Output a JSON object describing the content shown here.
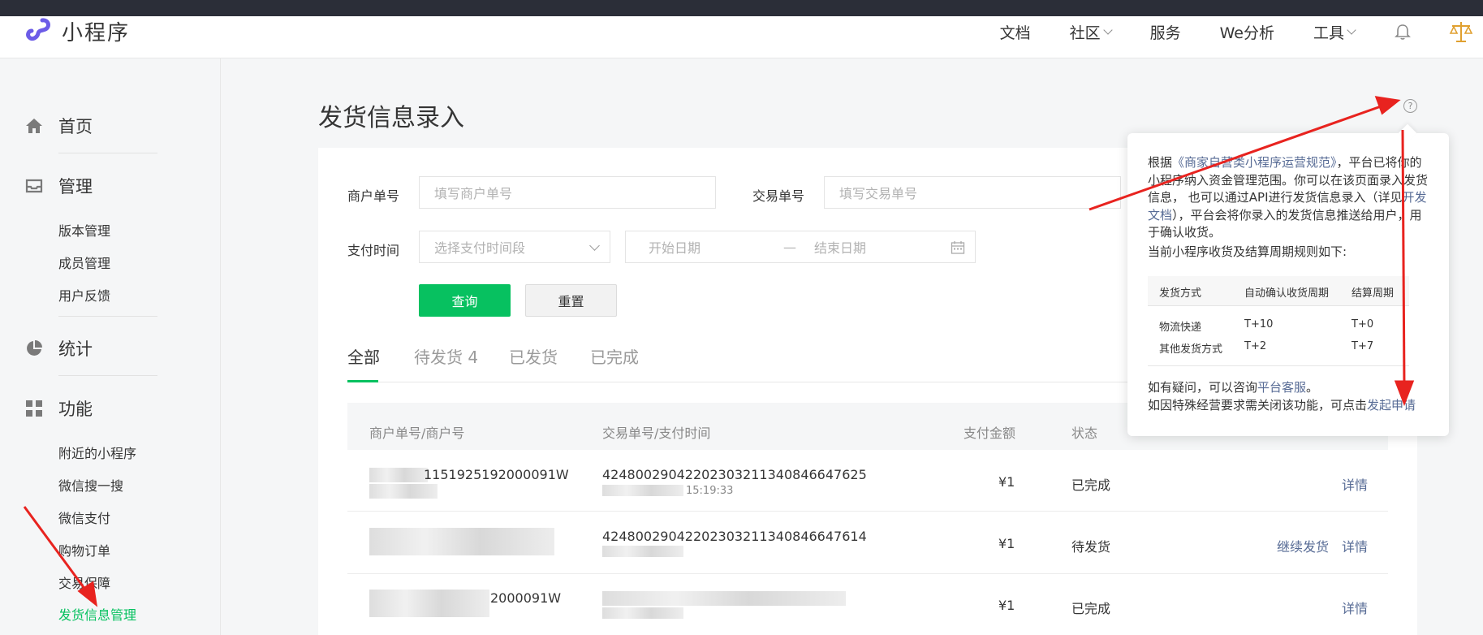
{
  "app": {
    "name": "小程序"
  },
  "topnav": {
    "items": [
      "文档",
      "社区",
      "服务",
      "We分析",
      "工具"
    ]
  },
  "sidebar": {
    "home": "首页",
    "manage": {
      "label": "管理",
      "items": [
        "版本管理",
        "成员管理",
        "用户反馈"
      ]
    },
    "stats": {
      "label": "统计"
    },
    "features": {
      "label": "功能",
      "items": [
        "附近的小程序",
        "微信搜一搜",
        "微信支付",
        "购物订单",
        "交易保障",
        "发货信息管理"
      ]
    }
  },
  "page": {
    "title": "发货信息录入"
  },
  "filters": {
    "merchant_label": "商户单号",
    "merchant_placeholder": "填写商户单号",
    "trade_label": "交易单号",
    "trade_placeholder": "填写交易单号",
    "paytime_label": "支付时间",
    "paytime_placeholder": "选择支付时间段",
    "start_placeholder": "开始日期",
    "range_sep": "—",
    "end_placeholder": "结束日期",
    "query": "查询",
    "reset": "重置"
  },
  "tabs": [
    "全部",
    "待发货 4",
    "已发货",
    "已完成"
  ],
  "table": {
    "headers": [
      "商户单号/商户号",
      "交易单号/支付时间",
      "支付金额",
      "状态"
    ],
    "rows": [
      {
        "merchant": "1151925192000091W",
        "trade": "4248002904220230321134084​6647625",
        "trade_sub": "15:19:33",
        "amount": "¥1",
        "status": "已完成",
        "actions": [
          "详情"
        ]
      },
      {
        "merchant": "",
        "trade": "42480029042202303211340846647614",
        "trade_sub": "",
        "amount": "¥1",
        "status": "待发货",
        "actions": [
          "继续发货",
          "详情"
        ]
      },
      {
        "merchant": "2000091W",
        "trade": "",
        "trade_sub": "",
        "amount": "¥1",
        "status": "已完成",
        "actions": [
          "详情"
        ]
      }
    ]
  },
  "popover": {
    "p1_before": "根据",
    "p1_link": "《商家自营类小程序运营规范》",
    "p1_after": "，平台已将你的小程序纳入资金管理范围。你可以在该页面录入发货信息， 也可以通过API进行发货信息录入（详见",
    "p1_link2": "开发文档",
    "p1_end": "），平台会将你录入的发货信息推送给用户，用于确认收货。",
    "p2": "当前小程序收货及结算周期规则如下:",
    "table_headers": [
      "发货方式",
      "自动确认收货周期",
      "结算周期"
    ],
    "table_rows": [
      [
        "物流快递",
        "T+10",
        "T+0"
      ],
      [
        "其他发货方式",
        "T+2",
        "T+7"
      ]
    ],
    "q_before": "如有疑问，可以咨询",
    "q_link": "平台客服",
    "q_after": "。",
    "c_before": "如因特殊经营要求需关闭该功能，可点击",
    "c_link": "发起申请"
  },
  "colors": {
    "accent": "#07c160",
    "link": "#576b95",
    "annotation": "#e8231f"
  }
}
